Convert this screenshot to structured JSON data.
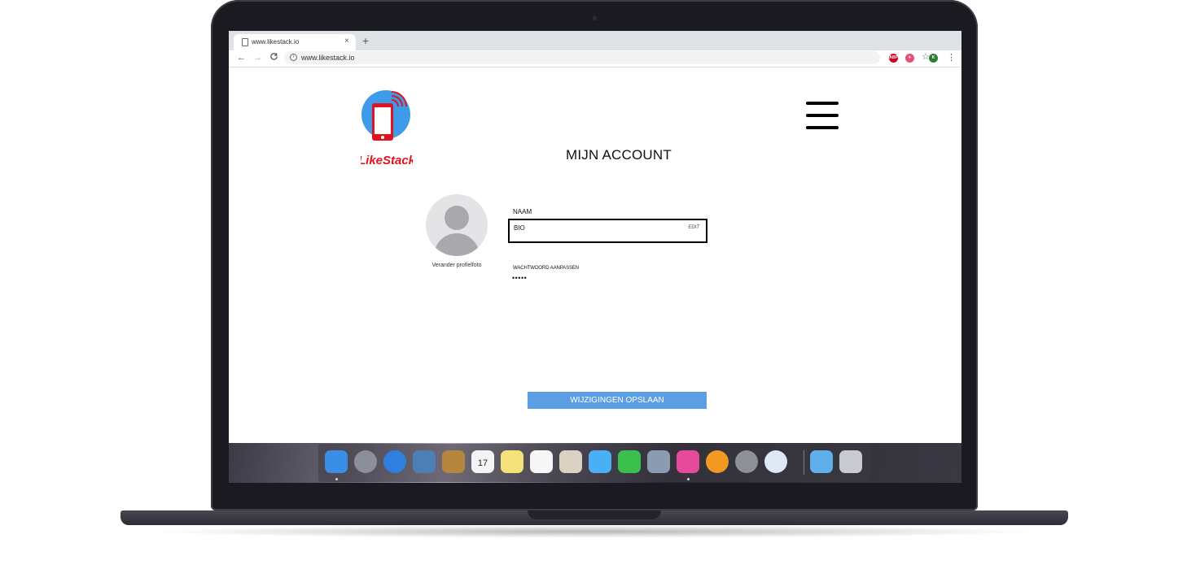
{
  "browser": {
    "tab_title": "www.likestack.io",
    "tab_close": "×",
    "new_tab": "+",
    "back": "←",
    "forward": "→",
    "reload": "C",
    "url": "www.likestack.io",
    "star": "☆",
    "extensions": [
      {
        "label": "ABP",
        "color": "#d0021b"
      },
      {
        "label": "♥",
        "color": "#e8507a"
      },
      {
        "label": "K",
        "color": "#2e7d32"
      }
    ],
    "menu": "⋮"
  },
  "page": {
    "logo_text": "LikeStack",
    "title": "MIJN ACCOUNT",
    "change_photo": "Verander profielfoto",
    "naam_label": "NAAM",
    "bio_label": "BIO",
    "edit_label": "EDIT",
    "password_label": "WACHTWOORD AANPASSEN",
    "password_value": "•••••",
    "save_button": "WIJZIGINGEN OPSLAAN"
  },
  "colors": {
    "accent_button": "#5b9ee3",
    "logo_circle": "#3d9be9",
    "logo_red": "#e0141e"
  },
  "dock": {
    "apps": [
      {
        "name": "finder-icon",
        "color": "#3a8ee6"
      },
      {
        "name": "launchpad-icon",
        "color": "#8a8f98"
      },
      {
        "name": "safari-icon",
        "color": "#2f7fe0"
      },
      {
        "name": "preview-icon",
        "color": "#4b7fb5"
      },
      {
        "name": "contacts-icon",
        "color": "#b7863e"
      },
      {
        "name": "calendar-icon",
        "color": "#f4f4f4",
        "text": "17"
      },
      {
        "name": "notes-icon",
        "color": "#f6e27a"
      },
      {
        "name": "reminders-icon",
        "color": "#f7f7f7"
      },
      {
        "name": "photo-booth-icon",
        "color": "#d9d2c2"
      },
      {
        "name": "messages-icon",
        "color": "#4ab0f5"
      },
      {
        "name": "facetime-icon",
        "color": "#3bbf4d"
      },
      {
        "name": "image-capture-icon",
        "color": "#8c9bb0"
      },
      {
        "name": "keynote-icon",
        "color": "#e64a9b"
      },
      {
        "name": "books-icon",
        "color": "#f29a20"
      },
      {
        "name": "system-preferences-icon",
        "color": "#8d9097"
      },
      {
        "name": "migration-assistant-icon",
        "color": "#dfe9f5"
      },
      {
        "name": "downloads-folder-icon",
        "color": "#5fb0ea"
      },
      {
        "name": "trash-icon",
        "color": "#c8cbd0"
      }
    ]
  }
}
